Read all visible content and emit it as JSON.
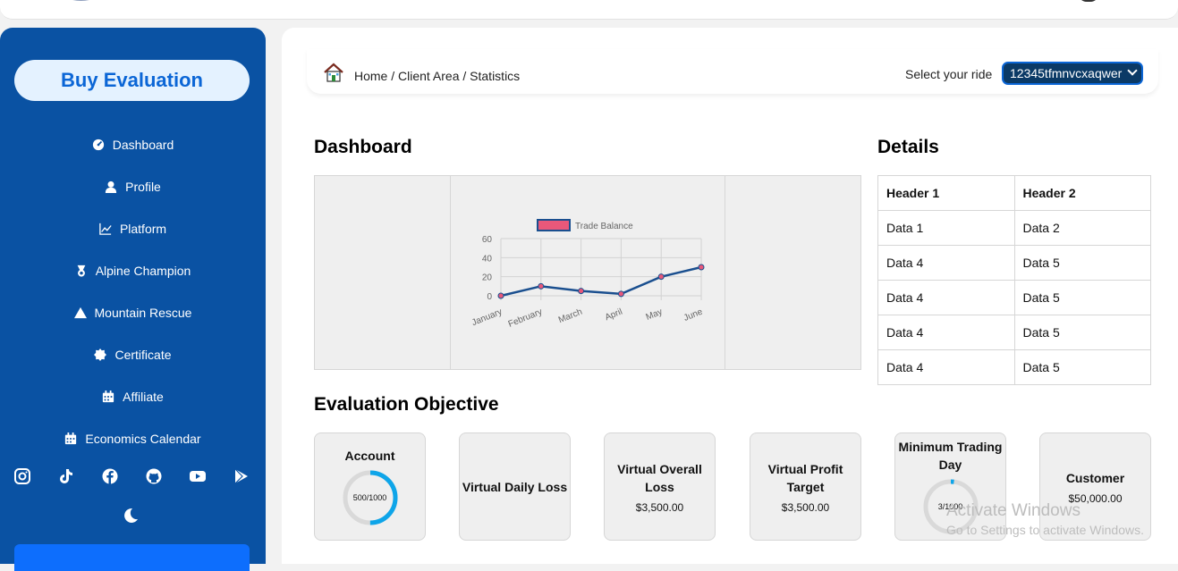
{
  "sidebar": {
    "buy_label": "Buy Evaluation",
    "items": [
      {
        "label": "Dashboard",
        "icon": "gauge-icon"
      },
      {
        "label": "Profile",
        "icon": "user-icon"
      },
      {
        "label": "Platform",
        "icon": "chart-line-icon"
      },
      {
        "label": "Alpine Champion",
        "icon": "medal-icon"
      },
      {
        "label": "Mountain Rescue",
        "icon": "mountain-icon"
      },
      {
        "label": "Certificate",
        "icon": "certificate-icon"
      },
      {
        "label": "Affiliate",
        "icon": "calendar-icon"
      },
      {
        "label": "Economics Calendar",
        "icon": "calendar-icon"
      }
    ],
    "socials": [
      "instagram-icon",
      "tiktok-icon",
      "facebook-icon",
      "github-icon",
      "youtube-icon",
      "google-play-icon"
    ],
    "theme_toggle_icon": "moon-icon",
    "accent_color": "#0a52a3"
  },
  "header": {
    "breadcrumb": "Home / Client Area / Statistics",
    "ride_label": "Select your ride",
    "ride_selected": "12345tfmnvcxaqwer"
  },
  "dashboard": {
    "title": "Dashboard",
    "chart_data": {
      "type": "line",
      "categories": [
        "January",
        "February",
        "March",
        "April",
        "May",
        "June"
      ],
      "series": [
        {
          "name": "Trade Balance",
          "values": [
            0,
            10,
            5,
            2,
            20,
            30
          ],
          "color": "#1a4f8f",
          "point_color": "#e8587a"
        }
      ],
      "yticks": [
        "0",
        "20",
        "40",
        "60"
      ],
      "ylim": [
        0,
        60
      ],
      "grid": true,
      "legend_position": "top"
    }
  },
  "details": {
    "title": "Details",
    "headers": [
      "Header 1",
      "Header 2"
    ],
    "rows": [
      [
        "Data 1",
        "Data 2"
      ],
      [
        "Data 4",
        "Data 5"
      ],
      [
        "Data 4",
        "Data 5"
      ],
      [
        "Data 4",
        "Data 5"
      ],
      [
        "Data 4",
        "Data 5"
      ]
    ]
  },
  "objective": {
    "title": "Evaluation Objective",
    "cards": [
      {
        "title": "Account",
        "ring_text": "500/1000",
        "progress": 0.5
      },
      {
        "title": "Virtual Daily Loss"
      },
      {
        "title": "Virtual Overall Loss",
        "value": "$3,500.00"
      },
      {
        "title": "Virtual Profit Target",
        "value": "$3,500.00"
      },
      {
        "title": "Minimum Trading Day",
        "ring_text": "3/1000",
        "progress": 0.003
      },
      {
        "title": "Customer",
        "value": "$50,000.00"
      }
    ],
    "ring_color": "#0ea5e9"
  },
  "watermark": {
    "line1": "Activate Windows",
    "line2": "Go to Settings to activate Windows."
  }
}
